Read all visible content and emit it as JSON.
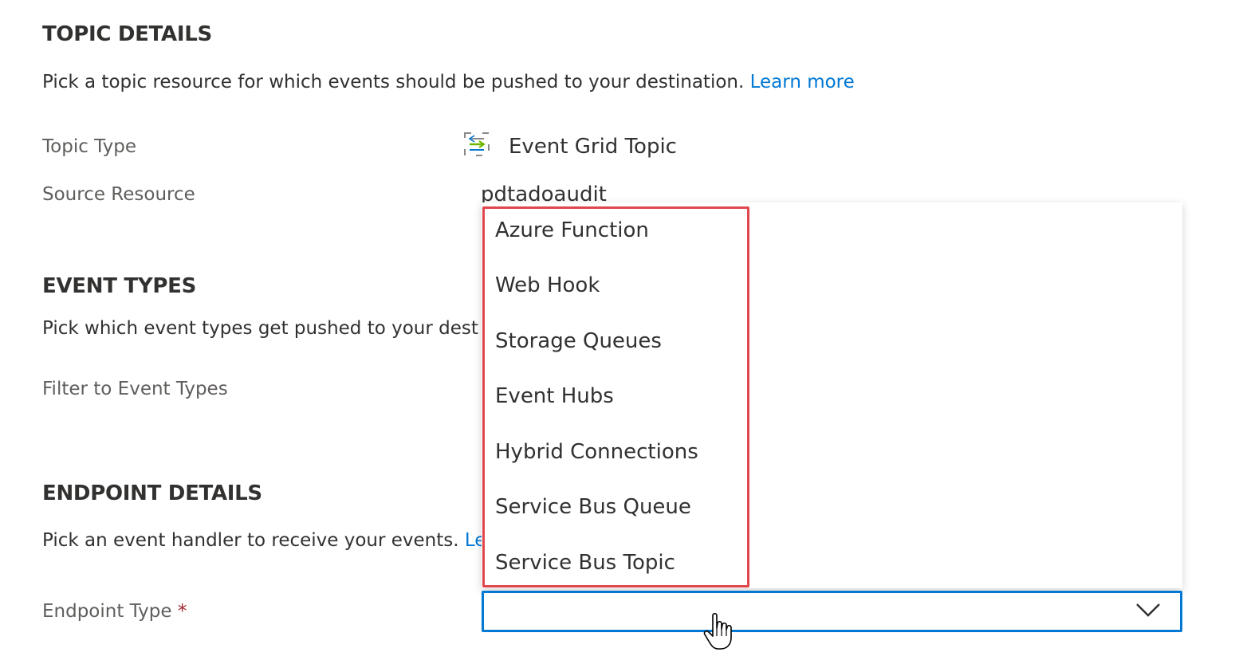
{
  "topic_details": {
    "title": "TOPIC DETAILS",
    "description": "Pick a topic resource for which events should be pushed to your destination.",
    "learn_more": "Learn more",
    "topic_type_label": "Topic Type",
    "topic_type_value": "Event Grid Topic",
    "topic_type_icon": "event-grid-icon",
    "source_resource_label": "Source Resource",
    "source_resource_value": "pdtadoaudit"
  },
  "event_types": {
    "title": "EVENT TYPES",
    "description": "Pick which event types get pushed to your dest",
    "filter_label": "Filter to Event Types"
  },
  "endpoint_details": {
    "title": "ENDPOINT DETAILS",
    "description": "Pick an event handler to receive your events.",
    "learn_more_partial": "Le",
    "endpoint_type_label": "Endpoint Type",
    "required_marker": "*",
    "endpoint_type_value": "",
    "options": [
      "Azure Function",
      "Web Hook",
      "Storage Queues",
      "Event Hubs",
      "Hybrid Connections",
      "Service Bus Queue",
      "Service Bus Topic"
    ]
  },
  "colors": {
    "link": "#0078d4",
    "focus_border": "#0078d4",
    "highlight": "#e0474c",
    "required": "#a4262c"
  }
}
